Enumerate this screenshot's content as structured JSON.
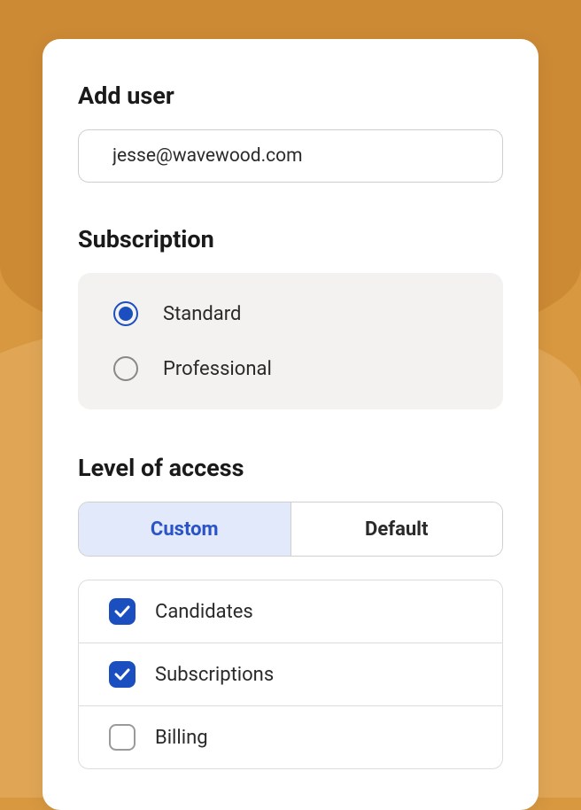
{
  "header": {
    "title": "Add user"
  },
  "email": {
    "value": "jesse@wavewood.com"
  },
  "subscription": {
    "title": "Subscription",
    "options": [
      {
        "label": "Standard",
        "selected": true
      },
      {
        "label": "Professional",
        "selected": false
      }
    ]
  },
  "access": {
    "title": "Level of access",
    "tabs": [
      {
        "label": "Custom",
        "active": true
      },
      {
        "label": "Default",
        "active": false
      }
    ],
    "permissions": [
      {
        "label": "Candidates",
        "checked": true
      },
      {
        "label": "Subscriptions",
        "checked": true
      },
      {
        "label": "Billing",
        "checked": false
      }
    ]
  },
  "colors": {
    "accent": "#1b4fbf",
    "segment_active_bg": "#e1e9fb",
    "segment_active_text": "#2a53c8",
    "bg_orange": "#d89840"
  }
}
